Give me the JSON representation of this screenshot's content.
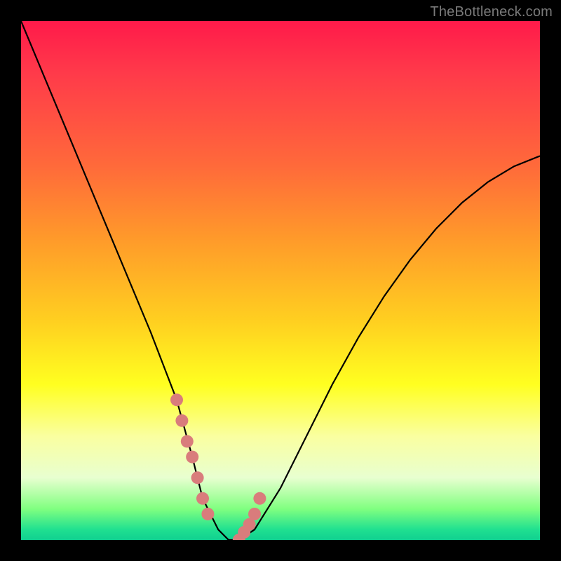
{
  "watermark": "TheBottleneck.com",
  "colors": {
    "background": "#000000",
    "curve": "#000000",
    "marker": "#d97c7c",
    "gradient_top": "#ff1a4a",
    "gradient_mid": "#ffff20",
    "gradient_bottom": "#10d090"
  },
  "chart_data": {
    "type": "line",
    "title": "",
    "xlabel": "",
    "ylabel": "",
    "xlim": [
      0,
      100
    ],
    "ylim": [
      0,
      100
    ],
    "series": [
      {
        "name": "bottleneck-curve",
        "x": [
          0,
          5,
          10,
          15,
          20,
          25,
          30,
          33,
          35,
          38,
          40,
          42,
          45,
          50,
          55,
          60,
          65,
          70,
          75,
          80,
          85,
          90,
          95,
          100
        ],
        "y": [
          100,
          88,
          76,
          64,
          52,
          40,
          27,
          16,
          8,
          2,
          0,
          0,
          2,
          10,
          20,
          30,
          39,
          47,
          54,
          60,
          65,
          69,
          72,
          74
        ]
      }
    ],
    "markers": {
      "name": "highlight-dots",
      "x": [
        30,
        31,
        32,
        33,
        34,
        35,
        36,
        42,
        43,
        44,
        45,
        46
      ],
      "y": [
        27,
        23,
        19,
        16,
        12,
        8,
        5,
        0,
        1.5,
        3,
        5,
        8
      ]
    },
    "annotations": [
      {
        "text": "TheBottleneck.com",
        "position": "top-right"
      }
    ]
  }
}
